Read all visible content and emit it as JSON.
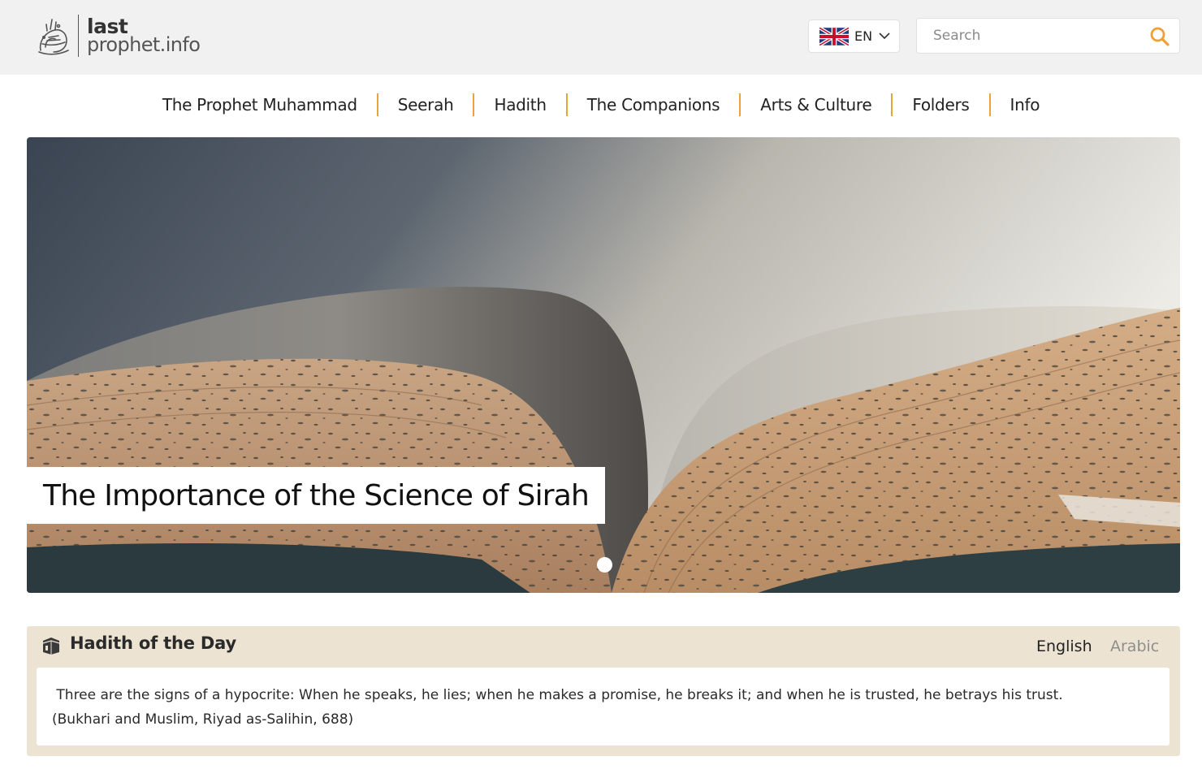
{
  "site": {
    "logo_line1": "last",
    "logo_line2": "prophet.info"
  },
  "header": {
    "language_code": "EN",
    "search_placeholder": "Search",
    "accent_color": "#f0a033"
  },
  "nav": {
    "items": [
      {
        "label": "The Prophet Muhammad"
      },
      {
        "label": "Seerah"
      },
      {
        "label": "Hadith"
      },
      {
        "label": "The Companions"
      },
      {
        "label": "Arts & Culture"
      },
      {
        "label": "Folders"
      },
      {
        "label": "Info"
      }
    ]
  },
  "hero": {
    "caption": "The Importance of the Science of Sirah"
  },
  "hadith": {
    "title": "Hadith of the Day",
    "tabs": [
      "English",
      "Arabic"
    ],
    "text": "Three are the signs of a hypocrite: When he speaks, he lies; when he makes a promise, he breaks it; and when he is trusted, he betrays his trust.",
    "source": "(Bukhari and Muslim, Riyad as-Salihin, 688)"
  }
}
